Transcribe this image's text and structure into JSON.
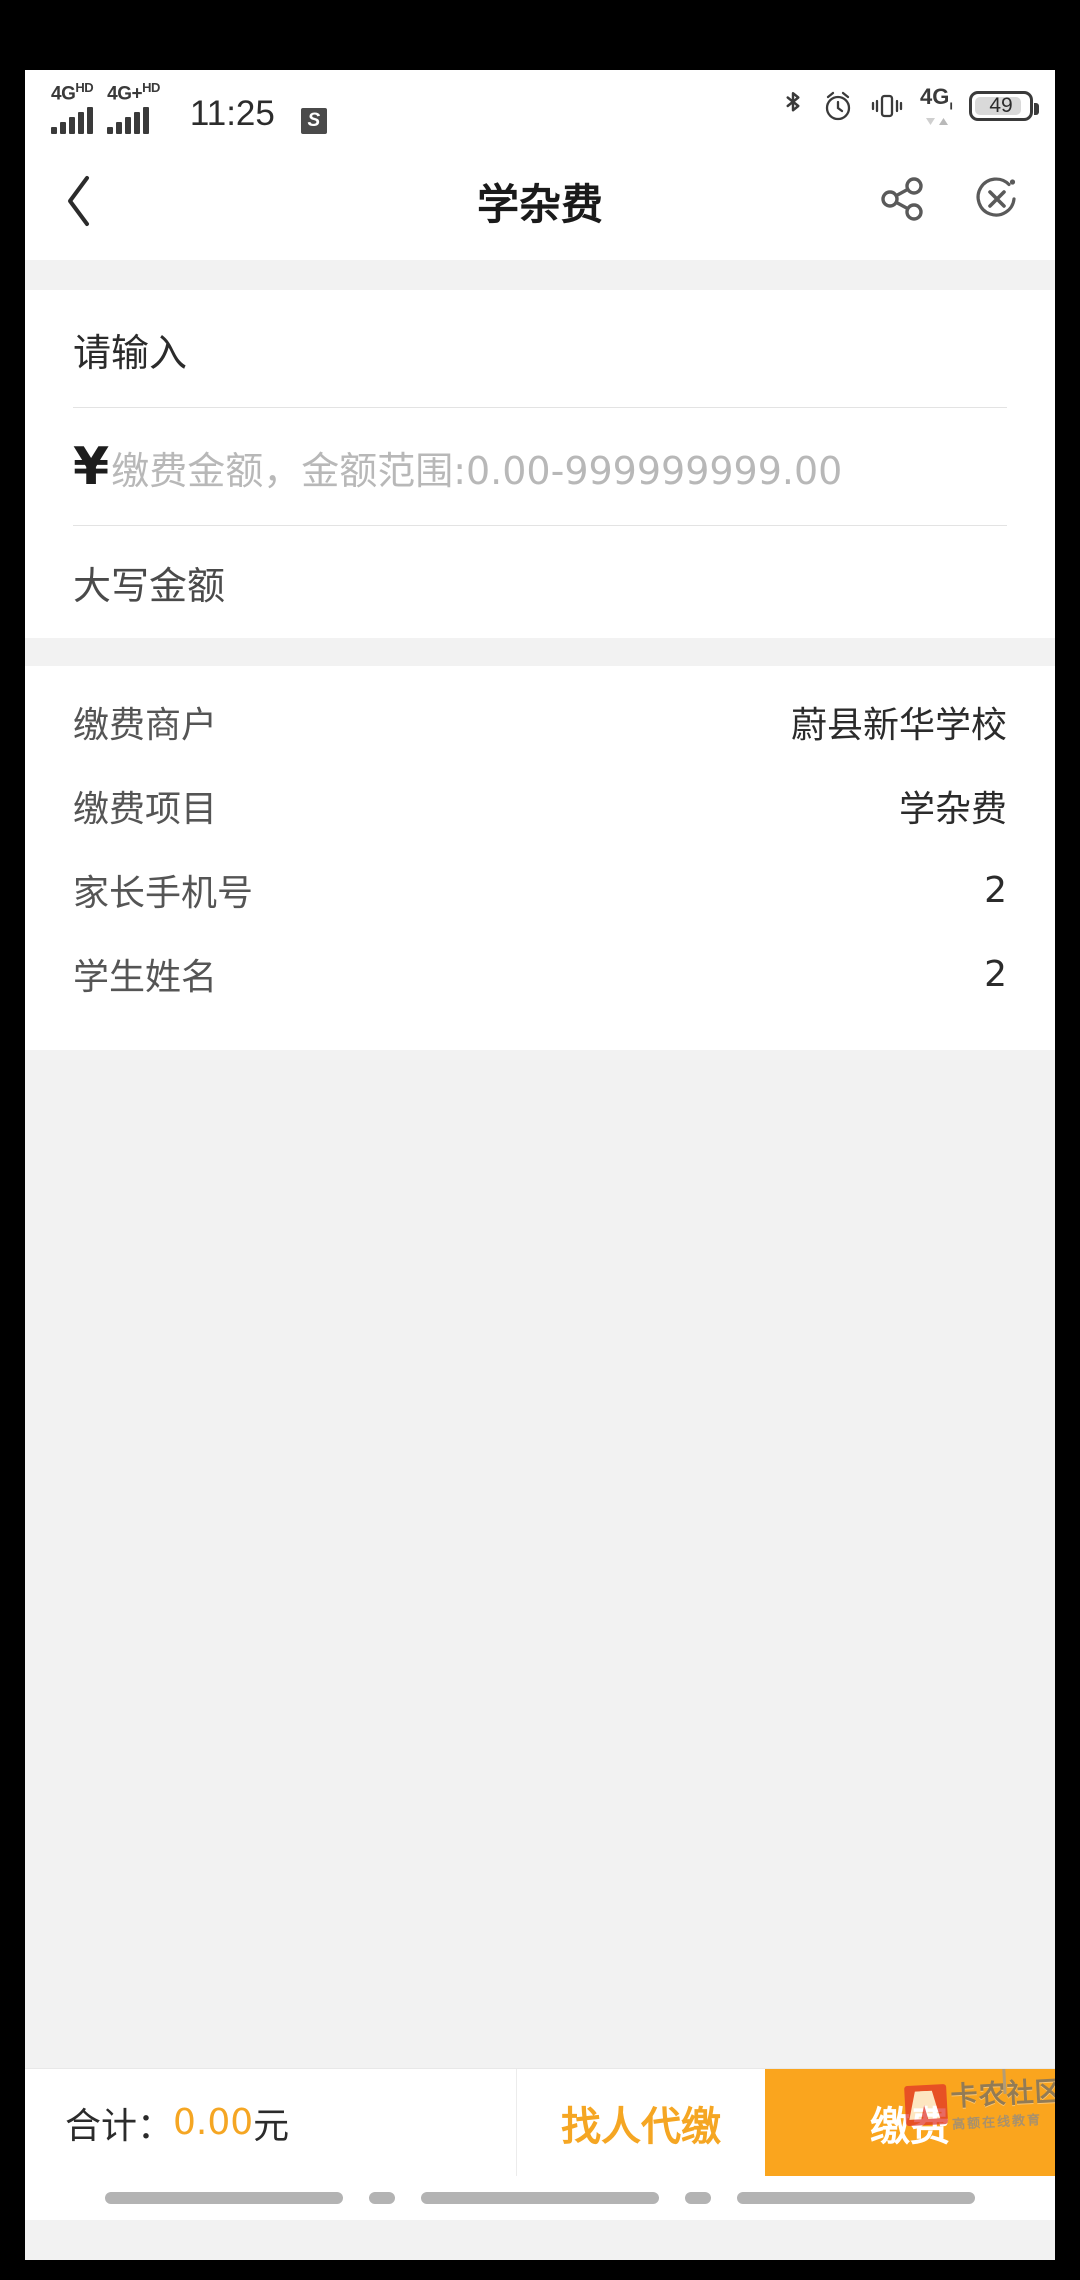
{
  "status_bar": {
    "sim1_network": "4G",
    "sim1_hd": "HD",
    "sim2_network": "4G+",
    "sim2_hd": "HD",
    "time": "11:25",
    "app_icon_letter": "S",
    "bluetooth_icon": "bluetooth-icon",
    "alarm_icon": "alarm-clock-icon",
    "vibrate_icon": "vibrate-icon",
    "data_network": "4G",
    "data_network_sub": "ı",
    "battery_percent": "49"
  },
  "title_bar": {
    "back_icon": "back-chevron-icon",
    "title": "学杂费",
    "share_icon": "share-icon",
    "close_icon": "close-circle-icon"
  },
  "form": {
    "name_value": "请输入",
    "currency_symbol": "¥",
    "amount_placeholder": "缴费金额，金额范围:0.00-999999999.00",
    "capital_amount_label": "大写金额",
    "capital_amount_value": ""
  },
  "details": {
    "rows": [
      {
        "label": "缴费商户",
        "value": "蔚县新华学校"
      },
      {
        "label": "缴费项目",
        "value": "学杂费"
      },
      {
        "label": "家长手机号",
        "value": "2"
      },
      {
        "label": "学生姓名",
        "value": "2"
      }
    ]
  },
  "bottom_bar": {
    "total_prefix": "合计：",
    "total_amount": "0.00",
    "total_unit": "元",
    "proxy_pay_label": "找人代缴",
    "pay_label": "缴费",
    "watermark_main": "卡农社区",
    "watermark_sub": "高额在线教育"
  },
  "colors": {
    "accent_orange": "#faa51e",
    "total_amount_color": "#f5a623",
    "background_grey": "#f2f2f2",
    "card_white": "#ffffff",
    "watermark_red": "#e03127"
  }
}
